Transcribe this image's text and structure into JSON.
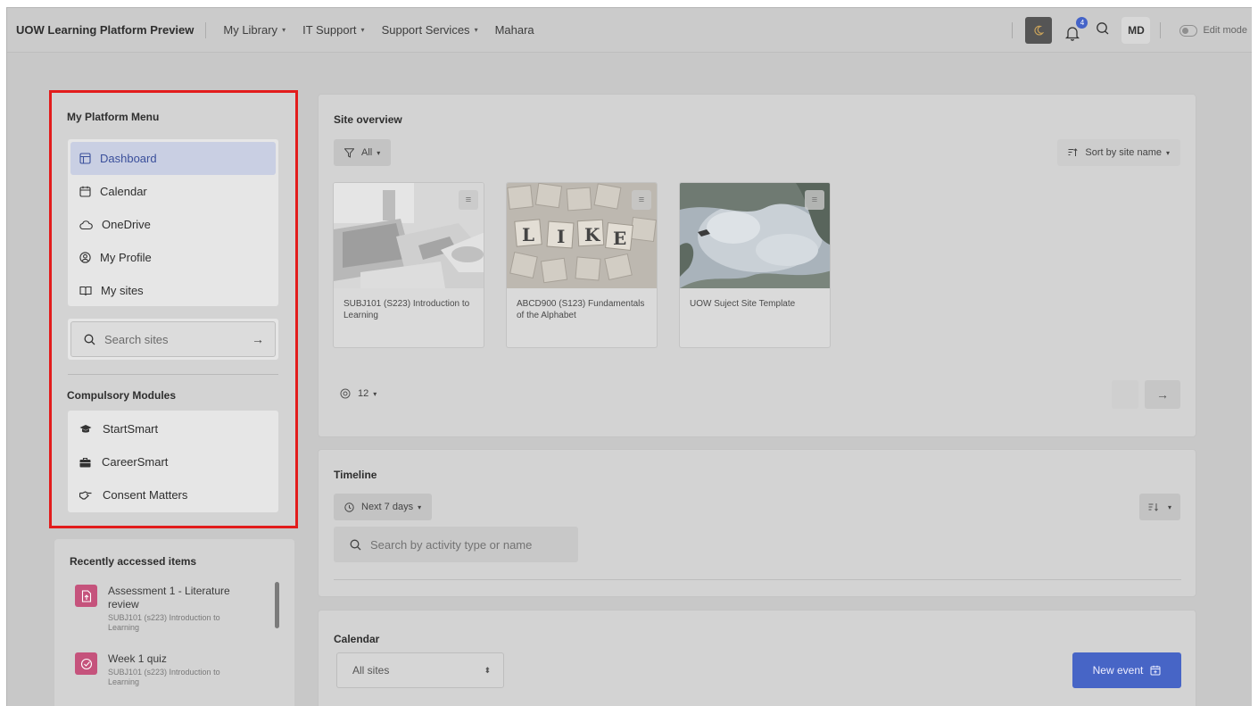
{
  "navbar": {
    "brand": "UOW Learning Platform Preview",
    "links": [
      {
        "label": "My Library",
        "caret": "▾"
      },
      {
        "label": "IT Support",
        "caret": "▾"
      },
      {
        "label": "Support Services",
        "caret": "▾"
      },
      {
        "label": "Mahara",
        "caret": ""
      }
    ],
    "notification_count": "4",
    "user_initials": "MD",
    "edit_mode_label": "Edit mode"
  },
  "platform_menu": {
    "title": "My Platform Menu",
    "items": [
      {
        "label": "Dashboard",
        "icon": "dashboard-icon",
        "active": true
      },
      {
        "label": "Calendar",
        "icon": "calendar-icon"
      },
      {
        "label": "OneDrive",
        "icon": "cloud-icon"
      },
      {
        "label": "My Profile",
        "icon": "profile-icon"
      },
      {
        "label": "My sites",
        "icon": "book-icon"
      }
    ],
    "search_placeholder": "Search sites",
    "search_arrow": "→"
  },
  "compulsory_modules": {
    "title": "Compulsory Modules",
    "items": [
      {
        "label": "StartSmart",
        "icon": "graduation-cap-icon"
      },
      {
        "label": "CareerSmart",
        "icon": "briefcase-icon"
      },
      {
        "label": "Consent Matters",
        "icon": "handshake-icon"
      }
    ]
  },
  "recent": {
    "title": "Recently accessed items",
    "items": [
      {
        "name": "Assessment 1 - Literature review",
        "site": "SUBJ101 (s223) Introduction to Learning",
        "icon": "assignment-icon"
      },
      {
        "name": "Week 1 quiz",
        "site": "SUBJ101 (s223) Introduction to Learning",
        "icon": "quiz-icon"
      }
    ]
  },
  "site_overview": {
    "title": "Site overview",
    "filter_label": "All",
    "sort_label": "Sort by site name",
    "sites": [
      {
        "name": "SUBJ101 (S223) Introduction to Learning"
      },
      {
        "name": "ABCD900 (S123) Fundamentals of the Alphabet"
      },
      {
        "name": "UOW Suject Site Template"
      }
    ],
    "tile_letters": [
      "L",
      "I",
      "K",
      "E"
    ],
    "per_page": "12",
    "next_arrow": "→"
  },
  "timeline": {
    "title": "Timeline",
    "range_label": "Next 7 days",
    "search_placeholder": "Search by activity type or name"
  },
  "calendar": {
    "title": "Calendar",
    "select_value": "All sites",
    "new_event_label": "New event"
  },
  "colors": {
    "accent": "#4765c6",
    "highlight_border": "#e21c1c",
    "recent_icon": "#c5537c"
  }
}
